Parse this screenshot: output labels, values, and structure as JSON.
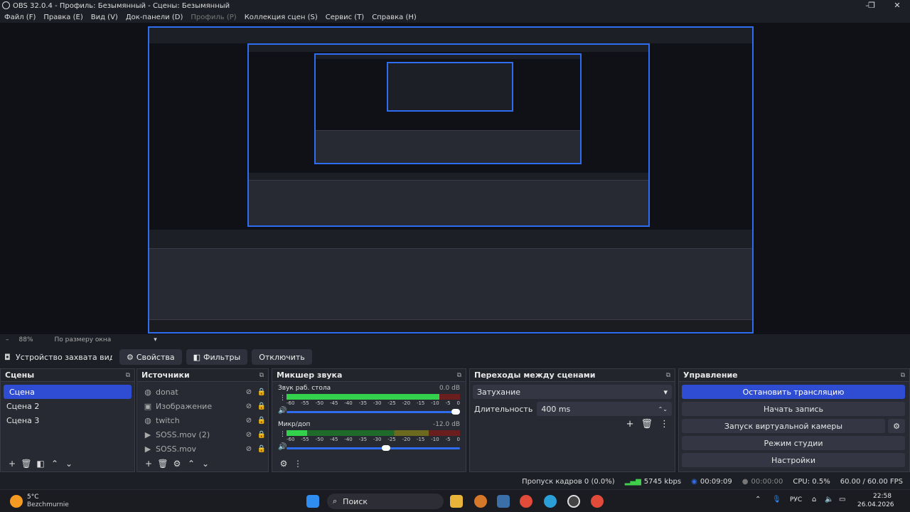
{
  "window": {
    "title": "OBS 32.0.4 - Профиль: Безымянный - Сцены: Безымянный",
    "min": "–",
    "max": "❐",
    "close": "✕"
  },
  "menu": [
    "Файл (F)",
    "Правка (E)",
    "Вид (V)",
    "Док-панели (D)",
    "Профиль (P)",
    "Коллекция сцен (S)",
    "Сервис (T)",
    "Справка (H)"
  ],
  "zoom": {
    "value": "88%",
    "mode": "По размеру окна",
    "minus": "–"
  },
  "source_toolbar": {
    "name": "Устройство захвата виде",
    "properties": "Свойства",
    "filters": "Фильтры",
    "disconnect": "Отключить"
  },
  "scenes": {
    "title": "Сцены",
    "items": [
      "Сцена",
      "Сцена 2",
      "Сцена 3"
    ]
  },
  "sources": {
    "title": "Источники",
    "items": [
      "donat",
      "Изображение",
      "twitch",
      "SOSS.mov (2)",
      "SOSS.mov"
    ]
  },
  "mixer": {
    "title": "Микшер звука",
    "channels": [
      {
        "name": "Звук раб. стола",
        "db": "0.0 dB",
        "level": 0.88,
        "volume": 1.0
      },
      {
        "name": "Микр/доп",
        "db": "-12.0 dB",
        "level": 0.12,
        "volume": 0.6
      }
    ],
    "scale": [
      "-60",
      "-55",
      "-50",
      "-45",
      "-40",
      "-35",
      "-30",
      "-25",
      "-20",
      "-15",
      "-10",
      "-5",
      "0"
    ]
  },
  "transitions": {
    "title": "Переходы между сценами",
    "type": "Затухание",
    "duration_label": "Длительность",
    "duration": "400 ms"
  },
  "controls": {
    "title": "Управление",
    "stop_stream": "Остановить трансляцию",
    "start_record": "Начать запись",
    "virtual_cam": "Запуск виртуальной камеры",
    "studio": "Режим студии",
    "settings": "Настройки"
  },
  "status": {
    "dropped": "Пропуск кадров 0 (0.0%)",
    "bitrate": "5745 kbps",
    "stream_time": "00:09:09",
    "rec_time": "00:00:00",
    "cpu": "CPU: 0.5%",
    "fps": "60.00 / 60.00 FPS"
  },
  "taskbar": {
    "temp": "5°C",
    "weather": "Bezchmurnie",
    "search": "Поиск",
    "lang": "РУС",
    "time": "22:58",
    "date": "26.04.2026"
  },
  "colors": {
    "accent": "#2e4dd2",
    "bg": "#1d1f26",
    "panel": "#272a33"
  }
}
